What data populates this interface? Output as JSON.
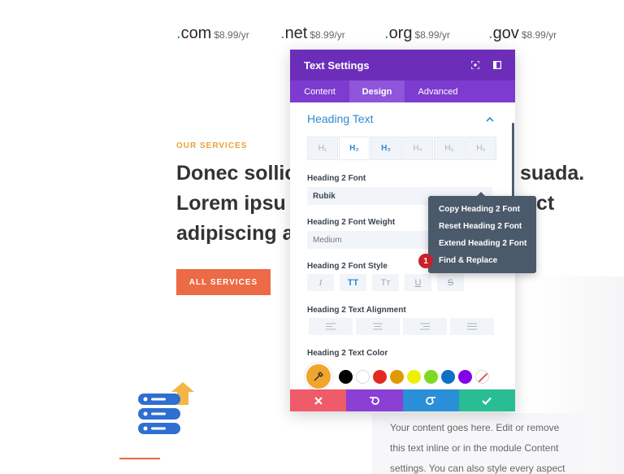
{
  "domains": [
    {
      "dot": ".",
      "tld": "com",
      "price": "$8.99/yr"
    },
    {
      "dot": ".",
      "tld": "net",
      "price": "$8.99/yr"
    },
    {
      "dot": ".",
      "tld": "org",
      "price": "$8.99/yr"
    },
    {
      "dot": ".",
      "tld": "gov",
      "price": "$8.99/yr"
    }
  ],
  "services": {
    "label": "OUR SERVICES",
    "headline_lines": [
      "Donec sollic",
      "Lorem ipsu",
      "adipiscing a"
    ],
    "headline_right": [
      "suada.",
      "ct"
    ],
    "button_label": "ALL SERVICES"
  },
  "content_text_lines": [
    "Your content goes here. Edit or remove",
    "this text inline or in the module Content",
    "settings. You can also style every aspect"
  ],
  "panel": {
    "title": "Text Settings",
    "tabs": [
      "Content",
      "Design",
      "Advanced"
    ],
    "section_title": "Heading Text",
    "heading_levels": [
      "H₁",
      "H₂",
      "H₃",
      "H₄",
      "H₅",
      "H₆"
    ],
    "font_label": "Heading 2 Font",
    "font_value": "Rubik",
    "weight_label": "Heading 2 Font Weight",
    "weight_value": "Medium",
    "style_label": "Heading 2 Font Style",
    "style_buttons": [
      "I",
      "TT",
      "Tᴛ",
      "U",
      "S"
    ],
    "align_label": "Heading 2 Text Alignment",
    "color_label": "Heading 2 Text Color",
    "swatches": [
      "#000000",
      "#ffffff",
      "#e02b20",
      "#e09900",
      "#edf000",
      "#7cda24",
      "#0c71c3",
      "#8300e9"
    ],
    "picker_color": "#f0a52b"
  },
  "context_menu": {
    "items": [
      "Copy Heading 2 Font",
      "Reset Heading 2 Font",
      "Extend Heading 2 Font",
      "Find & Replace"
    ]
  },
  "badge": "1",
  "colors": {
    "purple_header": "#6c2eb9",
    "accent_blue": "#2e8bd2",
    "orange_button": "#ec6a45",
    "discard": "#ef5b68",
    "undo": "#8c3fd4",
    "redo": "#2a8fd7",
    "save": "#28bd95"
  }
}
